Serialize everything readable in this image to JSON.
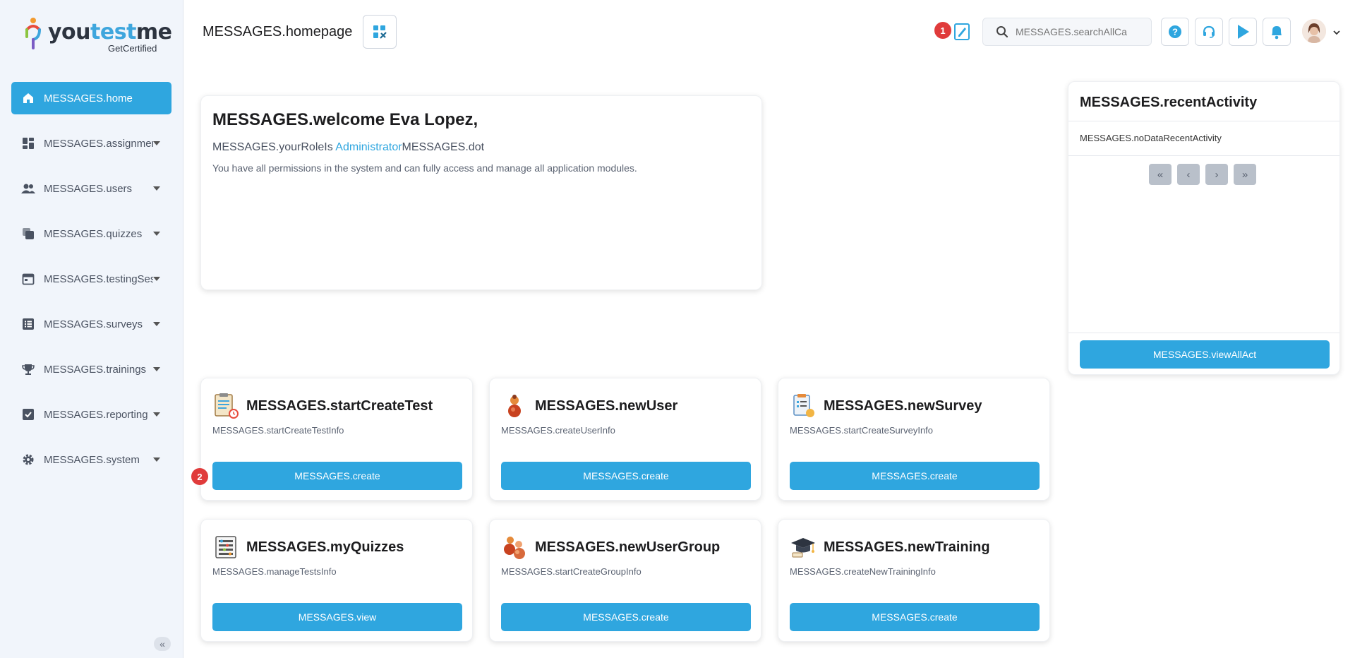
{
  "brand": {
    "name_part1": "you",
    "name_part2": "test",
    "name_part3": "me",
    "sub": "GetCertified"
  },
  "sidebar": {
    "items": [
      {
        "label": "MESSAGES.home",
        "icon": "home-icon",
        "active": true
      },
      {
        "label": "MESSAGES.assignment",
        "icon": "dashboard-icon"
      },
      {
        "label": "MESSAGES.users",
        "icon": "users-icon"
      },
      {
        "label": "MESSAGES.quizzes",
        "icon": "copy-icon"
      },
      {
        "label": "MESSAGES.testingSess",
        "icon": "calendar-icon"
      },
      {
        "label": "MESSAGES.surveys",
        "icon": "list-icon"
      },
      {
        "label": "MESSAGES.trainings",
        "icon": "trophy-icon"
      },
      {
        "label": "MESSAGES.reporting",
        "icon": "check-square-icon"
      },
      {
        "label": "MESSAGES.system",
        "icon": "gear-icon"
      }
    ],
    "collapse": "«"
  },
  "header": {
    "title": "MESSAGES.homepage",
    "badge1": "1",
    "search_placeholder": "MESSAGES.searchAllCa"
  },
  "welcome": {
    "title": "MESSAGES.welcome Eva Lopez,",
    "role_prefix": "MESSAGES.yourRoleIs ",
    "role_link": "Administrator",
    "role_suffix": "MESSAGES.dot",
    "description": "You have all permissions in the system and can fully access and manage all application modules."
  },
  "recent": {
    "title": "MESSAGES.recentActivity",
    "empty": "MESSAGES.noDataRecentActivity",
    "pager": [
      "«",
      "‹",
      "›",
      "»"
    ],
    "button": "MESSAGES.viewAllAct"
  },
  "badge2": "2",
  "actions": [
    {
      "title": "MESSAGES.startCreateTest",
      "info": "MESSAGES.startCreateTestInfo",
      "button": "MESSAGES.create",
      "icon": "test-clipboard-icon"
    },
    {
      "title": "MESSAGES.newUser",
      "info": "MESSAGES.createUserInfo",
      "button": "MESSAGES.create",
      "icon": "user-icon"
    },
    {
      "title": "MESSAGES.newSurvey",
      "info": "MESSAGES.startCreateSurveyInfo",
      "button": "MESSAGES.create",
      "icon": "survey-clipboard-icon"
    },
    {
      "title": "MESSAGES.myQuizzes",
      "info": "MESSAGES.manageTestsInfo",
      "button": "MESSAGES.view",
      "icon": "abacus-icon"
    },
    {
      "title": "MESSAGES.newUserGroup",
      "info": "MESSAGES.startCreateGroupInfo",
      "button": "MESSAGES.create",
      "icon": "user-group-icon"
    },
    {
      "title": "MESSAGES.newTraining",
      "info": "MESSAGES.createNewTrainingInfo",
      "button": "MESSAGES.create",
      "icon": "graduation-cap-icon"
    }
  ],
  "colors": {
    "accent": "#2fa6df",
    "sidebar_bg": "#f1f5fb",
    "badge": "#e03b3b"
  }
}
